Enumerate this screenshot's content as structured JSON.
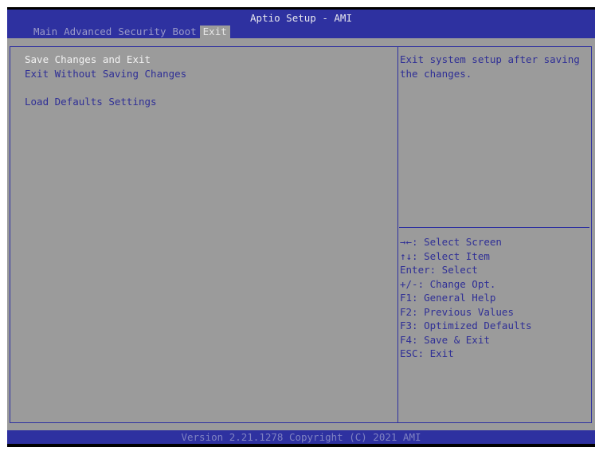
{
  "header": {
    "title": "Aptio Setup - AMI",
    "tabs": [
      {
        "label": "Main"
      },
      {
        "label": "Advanced"
      },
      {
        "label": "Security"
      },
      {
        "label": "Boot"
      },
      {
        "label": "Exit",
        "active": true
      }
    ]
  },
  "menu": {
    "items": [
      {
        "label": "Save Changes and Exit",
        "selected": true
      },
      {
        "label": "Exit Without Saving Changes"
      },
      {
        "label": "Load Defaults Settings"
      }
    ]
  },
  "help": {
    "text": "Exit system setup after saving the changes."
  },
  "keys": [
    "→←: Select Screen",
    "↑↓: Select Item",
    "Enter: Select",
    "+/-: Change Opt.",
    "F1: General Help",
    "F2: Previous Values",
    "F3: Optimized Defaults",
    "F4: Save & Exit",
    "ESC: Exit"
  ],
  "footer": {
    "text": "Version 2.21.1278 Copyright (C) 2021 AMI"
  },
  "colors": {
    "blue": "#2e31a0",
    "gray": "#9b9b9b"
  }
}
